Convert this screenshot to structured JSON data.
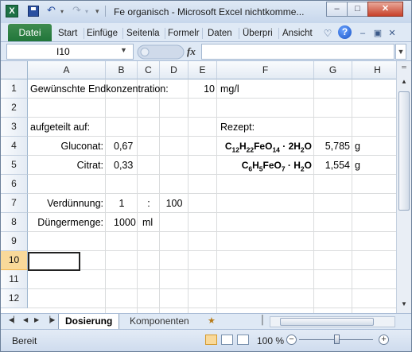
{
  "window": {
    "app_icon": "excel-icon",
    "title": "Fe organisch  -  Microsoft Excel nichtkomme...",
    "qat": {
      "save_icon": "save-icon",
      "undo_icon": "undo-icon",
      "redo_icon": "redo-icon"
    },
    "controls": {
      "minimize": "–",
      "maximize": "□",
      "close": "✕"
    }
  },
  "ribbon": {
    "file_tab": "Datei",
    "tabs": [
      "Start",
      "Einfüge",
      "Seitenla",
      "Formelr",
      "Daten",
      "Überpri",
      "Ansicht"
    ],
    "help_icon": "?"
  },
  "formula_bar": {
    "name_box": "I10",
    "fx_label": "fx",
    "formula": ""
  },
  "sheet": {
    "columns": [
      "A",
      "B",
      "C",
      "D",
      "E",
      "F",
      "G",
      "H"
    ],
    "rows": [
      "1",
      "2",
      "3",
      "4",
      "5",
      "6",
      "7",
      "8",
      "9",
      "10",
      "11",
      "12"
    ],
    "selected_row": "10",
    "cells": {
      "A1": "Gewünschte Endkonzentration:",
      "E1": "10",
      "F1": "mg/l",
      "A3": "aufgeteilt auf:",
      "F3": "Rezept:",
      "A4": "Gluconat:",
      "B4": "0,67",
      "G4": "5,785",
      "H4": "g",
      "A5": "Citrat:",
      "B5": "0,33",
      "G5": "1,554",
      "H5": "g",
      "A7": "Verdünnung:",
      "B7": "1",
      "C7": ":",
      "D7": "100",
      "A8": "Düngermenge:",
      "B8": "1000",
      "C8": "ml"
    },
    "formulas": {
      "F4": {
        "parts": [
          "C",
          "12",
          "H",
          "22",
          "FeO",
          "14",
          " · 2H",
          "2",
          "O"
        ]
      },
      "F5": {
        "parts": [
          "C",
          "6",
          "H",
          "5",
          "FeO",
          "7",
          " · H",
          "2",
          "O"
        ]
      }
    }
  },
  "sheet_tabs": {
    "tabs": [
      "Dosierung",
      "Komponenten"
    ],
    "active": "Dosierung"
  },
  "status_bar": {
    "status": "Bereit",
    "zoom": "100 %",
    "zoom_out": "−",
    "zoom_in": "+",
    "zoom_level": 1.0
  }
}
